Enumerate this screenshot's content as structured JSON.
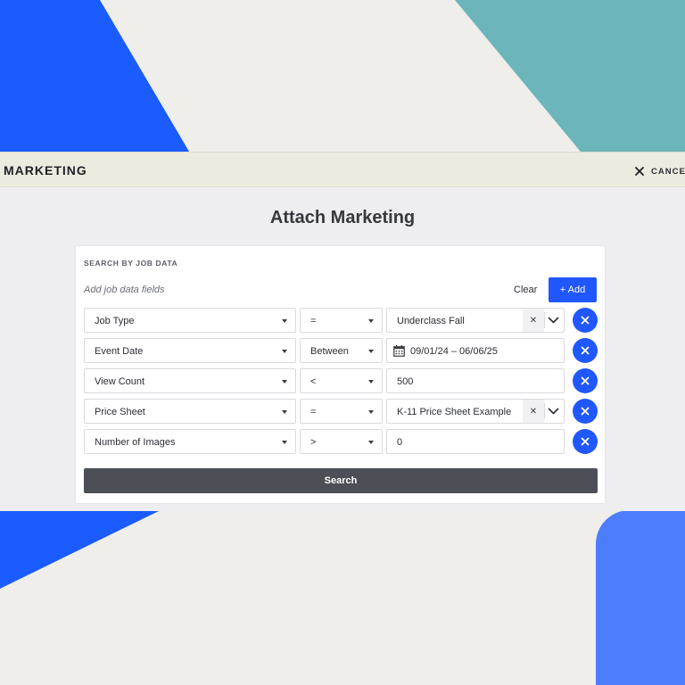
{
  "header": {
    "title": "MARKETING",
    "cancel_label": "CANCEL"
  },
  "page": {
    "title": "Attach Marketing"
  },
  "search": {
    "section_label": "SEARCH BY JOB DATA",
    "add_placeholder": "Add job data fields",
    "clear_label": "Clear",
    "add_label": "+ Add",
    "submit_label": "Search",
    "rows": [
      {
        "field": "Job Type",
        "operator": "=",
        "value": "Underclass Fall"
      },
      {
        "field": "Event Date",
        "operator": "Between",
        "value": "09/01/24 – 06/06/25"
      },
      {
        "field": "View Count",
        "operator": "<",
        "value": "500"
      },
      {
        "field": "Price Sheet",
        "operator": "=",
        "value": "K-11 Price Sheet Example"
      },
      {
        "field": "Number of Images",
        "operator": ">",
        "value": "0"
      }
    ]
  },
  "colors": {
    "accent": "#2057ff",
    "search_button": "#4d4f56",
    "header_bg": "#ecebe0"
  },
  "icons": {
    "cancel": "close-icon",
    "remove": "close-icon",
    "dropdown": "caret-down-icon",
    "value_menu": "chevron-down-icon",
    "date": "calendar-icon"
  }
}
